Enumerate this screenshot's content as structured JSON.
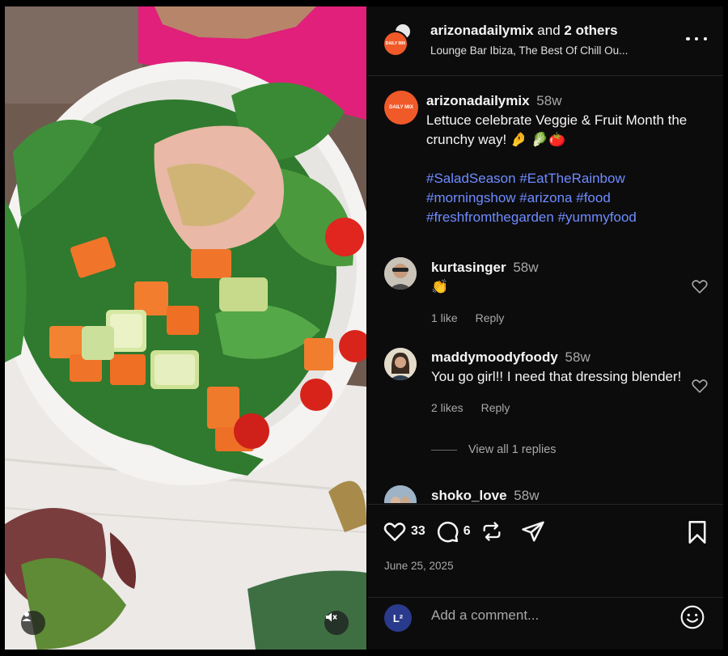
{
  "post": {
    "authors_primary": "arizonadailymix",
    "authors_rest": "and",
    "authors_others": "2 others",
    "audio": "Lounge Bar Ibiza, The Best Of Chill Ou...",
    "avatar_text": "DAILY MIX"
  },
  "caption": {
    "username": "arizonadailymix",
    "time": "58w",
    "text": "Lettuce celebrate Veggie & Fruit Month the crunchy way! 🤌 🥬🍅",
    "hashtags": [
      "#SaladSeason",
      "#EatTheRainbow",
      "#morningshow",
      "#arizona",
      "#food",
      "#freshfromthegarden",
      "#yummyfood"
    ]
  },
  "comments": [
    {
      "username": "kurtasinger",
      "time": "58w",
      "text": "👏",
      "likes": "1 like",
      "reply": "Reply",
      "avatar_color": "#b9a892"
    },
    {
      "username": "maddymoodyfoody",
      "time": "58w",
      "text": "You go girl!! I need that dressing blender!",
      "likes": "2 likes",
      "reply": "Reply",
      "avatar_color": "#c6b59a"
    },
    {
      "username": "shoko_love",
      "time": "58w",
      "avatar_color": "#8a9fb3"
    }
  ],
  "view_replies": "View all 1 replies",
  "actions": {
    "like_count": "33",
    "comment_count": "6",
    "date": "June 25, 2025"
  },
  "composer": {
    "placeholder": "Add a comment...",
    "avatar_text": "L²"
  },
  "colors": {
    "panel_bg": "#0c0c0d",
    "link": "#6f8cff",
    "muted": "#a8a8a8",
    "brand": "#f05a28"
  }
}
